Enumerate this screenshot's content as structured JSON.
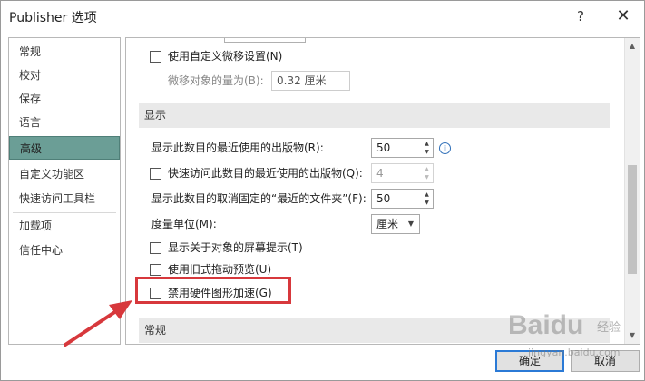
{
  "window": {
    "title": "Publisher 选项",
    "help_glyph": "?",
    "close_glyph": "✕"
  },
  "sidebar": {
    "items": [
      {
        "label": "常规"
      },
      {
        "label": "校对"
      },
      {
        "label": "保存"
      },
      {
        "label": "语言"
      },
      {
        "label": "高级",
        "selected": true
      },
      {
        "label": "自定义功能区"
      },
      {
        "label": "快速访问工具栏"
      },
      {
        "label": "加载项"
      },
      {
        "label": "信任中心"
      }
    ]
  },
  "content": {
    "custom_nudge_checkbox": {
      "label": "使用自定义微移设置(N)",
      "checked": false
    },
    "nudge_amount": {
      "label": "微移对象的量为(B):",
      "value": "0.32 厘米"
    },
    "display_section": {
      "title": "显示"
    },
    "recent_pubs": {
      "label": "显示此数目的最近使用的出版物(R):",
      "value": "50"
    },
    "quick_access_recent": {
      "label": "快速访问此数目的最近使用的出版物(Q):",
      "value": "4",
      "checked": false
    },
    "unpinned_folders": {
      "label": "显示此数目的取消固定的“最近的文件夹”(F):",
      "value": "50"
    },
    "units": {
      "label": "度量单位(M):",
      "value": "厘米"
    },
    "screen_tips": {
      "label": "显示关于对象的屏幕提示(T)",
      "checked": false
    },
    "legacy_drag": {
      "label": "使用旧式拖动预览(U)",
      "checked": false
    },
    "disable_hw_accel": {
      "label": "禁用硬件图形加速(G)",
      "checked": false
    },
    "general_section": {
      "title": "常规"
    }
  },
  "footer": {
    "ok_label": "确定",
    "cancel_label": "取消"
  },
  "annotation": {
    "highlight_color": "#d7383c"
  },
  "watermark": {
    "brand": "Baidu",
    "sub": "经验",
    "url": "jingyan.baidu.com"
  }
}
